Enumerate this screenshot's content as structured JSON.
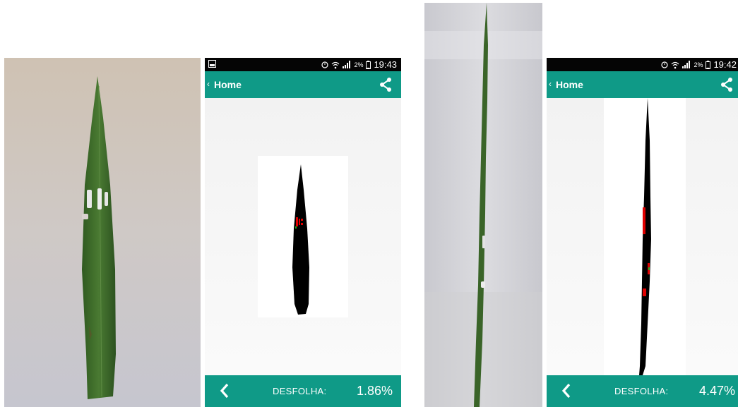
{
  "panels": [
    {
      "status_time": "19:43",
      "battery_pct": "2%",
      "title": "Home",
      "back_chevron": "‹",
      "metric_label": "DESFOLHA:",
      "metric_value": "1.86%"
    },
    {
      "status_time": "19:42",
      "battery_pct": "2%",
      "title": "Home",
      "back_chevron": "‹",
      "metric_label": "DESFOLHA:",
      "metric_value": "4.47%"
    }
  ],
  "colors": {
    "accent": "#0f9a87",
    "statusbar": "#050505",
    "leaf": "#3f6a2a",
    "mask": "#000000",
    "damage": "#e00000"
  },
  "icons": [
    "image-icon",
    "alarm-icon",
    "wifi-icon",
    "signal-icon",
    "battery-icon",
    "share-icon",
    "back-arrow-icon"
  ]
}
